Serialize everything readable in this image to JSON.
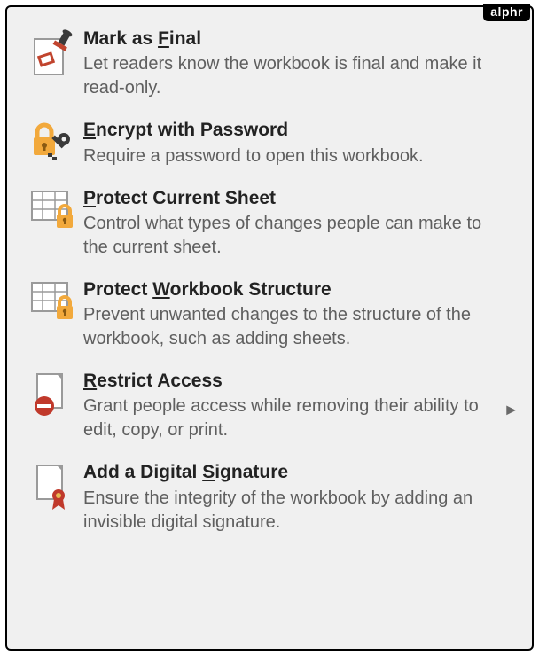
{
  "watermark": "alphr",
  "menu": {
    "items": [
      {
        "id": "mark-as-final",
        "title_pre": "Mark as ",
        "mnemonic": "F",
        "title_post": "inal",
        "desc": "Let readers know the workbook is final and make it read-only.",
        "has_submenu": false
      },
      {
        "id": "encrypt-with-password",
        "title_pre": "",
        "mnemonic": "E",
        "title_post": "ncrypt with Password",
        "desc": "Require a password to open this workbook.",
        "has_submenu": false
      },
      {
        "id": "protect-current-sheet",
        "title_pre": "",
        "mnemonic": "P",
        "title_post": "rotect Current Sheet",
        "desc": "Control what types of changes people can make to the current sheet.",
        "has_submenu": false
      },
      {
        "id": "protect-workbook-structure",
        "title_pre": "Protect ",
        "mnemonic": "W",
        "title_post": "orkbook Structure",
        "desc": "Prevent unwanted changes to the structure of the workbook, such as adding sheets.",
        "has_submenu": false
      },
      {
        "id": "restrict-access",
        "title_pre": "",
        "mnemonic": "R",
        "title_post": "estrict Access",
        "desc": "Grant people access while removing their ability to edit, copy, or print.",
        "has_submenu": true
      },
      {
        "id": "add-digital-signature",
        "title_pre": "Add a Digital ",
        "mnemonic": "S",
        "title_post": "ignature",
        "desc": "Ensure the integrity of the workbook by adding an invisible digital signature.",
        "has_submenu": false
      }
    ]
  }
}
